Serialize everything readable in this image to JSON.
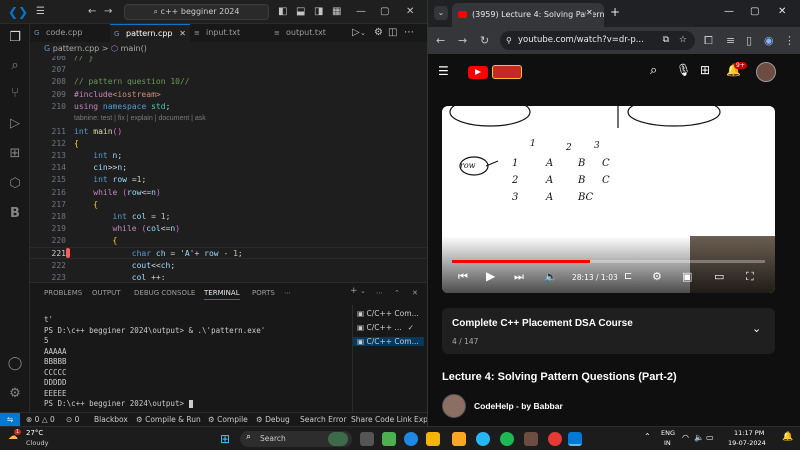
{
  "vscode": {
    "search": "c++ begginer 2024",
    "tabs": [
      {
        "label": "code.cpp"
      },
      {
        "label": "pattern.cpp"
      },
      {
        "label": "input.txt"
      },
      {
        "label": "output.txt"
      }
    ],
    "breadcrumb_file": "pattern.cpp",
    "breadcrumb_sep": ">",
    "breadcrumb_symbol": "main()",
    "codelens": "tabnine: test | fix | explain | document | ask",
    "lines": [
      {
        "n": "206",
        "code": "// }"
      },
      {
        "n": "207",
        "code": ""
      },
      {
        "n": "208",
        "code": "// pattern question 10//"
      },
      {
        "n": "209",
        "code": "#include<iostream>"
      },
      {
        "n": "210",
        "code": "using namespace std;"
      },
      {
        "n": "211",
        "code": "int main()"
      },
      {
        "n": "212",
        "code": "{"
      },
      {
        "n": "213",
        "code": "    int n;"
      },
      {
        "n": "214",
        "code": "    cin>>n;"
      },
      {
        "n": "215",
        "code": "    int row =1;"
      },
      {
        "n": "216",
        "code": "    while (row<=n)"
      },
      {
        "n": "217",
        "code": "    {"
      },
      {
        "n": "218",
        "code": "        int col = 1;"
      },
      {
        "n": "219",
        "code": "        while (col<=n)"
      },
      {
        "n": "220",
        "code": "        {"
      },
      {
        "n": "221",
        "code": "            char ch = 'A'+ row - 1;"
      },
      {
        "n": "222",
        "code": "            cout<<ch;"
      },
      {
        "n": "223",
        "code": "            col ++;"
      }
    ],
    "panel_tabs": [
      "PROBLEMS",
      "OUTPUT",
      "DEBUG CONSOLE",
      "TERMINAL",
      "PORTS"
    ],
    "terminal_lines": [
      "t'",
      "PS D:\\c++ begginer 2024\\output> & .\\'pattern.exe'",
      "5",
      "AAAAA",
      "BBBBB",
      "CCCCC",
      "DDDDD",
      "EEEEE",
      "PS D:\\c++ begginer 2024\\output> "
    ],
    "terminal_list": [
      "C/C++ Com...",
      "C/C++ ...",
      "C/C++ Com..."
    ],
    "status": {
      "errors": "0",
      "warnings": "0",
      "ports": "0",
      "blackbox": "Blackbox",
      "compile_run": "Compile & Run",
      "compile": "Compile",
      "debug": "Debug",
      "search_error": "Search Error",
      "share": "Share Code Link",
      "exp": "Exp"
    }
  },
  "chrome": {
    "tab_title": "(3959) Lecture 4: Solving Pattern Q",
    "url": "youtube.com/watch?v=dr-p...",
    "notif_count": "9+",
    "video_time": "28:13 / 1:03",
    "playlist_title": "Complete C++ Placement DSA Course",
    "playlist_count": "4 / 147",
    "video_title": "Lecture 4: Solving Pattern Questions (Part-2)",
    "channel": "CodeHelp - by Babbar",
    "progress_pct": 44,
    "whiteboard": {
      "row_label": "row",
      "rows": [
        [
          "1",
          "A",
          "B",
          "C"
        ],
        [
          "2",
          "A",
          "B",
          "C"
        ],
        [
          "3",
          "A",
          "BC",
          ""
        ]
      ],
      "cols": [
        "1",
        "2",
        "3"
      ],
      "top_left": "A' + i - 1"
    }
  },
  "taskbar": {
    "weather_temp": "27°C",
    "weather_desc": "Cloudy",
    "search": "Search",
    "lang": "ENG",
    "region": "IN",
    "time": "11:17 PM",
    "date": "19-07-2024"
  },
  "colors": {
    "vs_accent": "#0078d4",
    "yt_red": "#ff0000",
    "keyword": "#569cd6",
    "control": "#c586c0",
    "comment": "#6a9955",
    "string": "#ce9178",
    "func": "#dcdcaa",
    "var": "#9cdcfe",
    "type": "#4ec9b0",
    "number": "#b5cea8"
  }
}
